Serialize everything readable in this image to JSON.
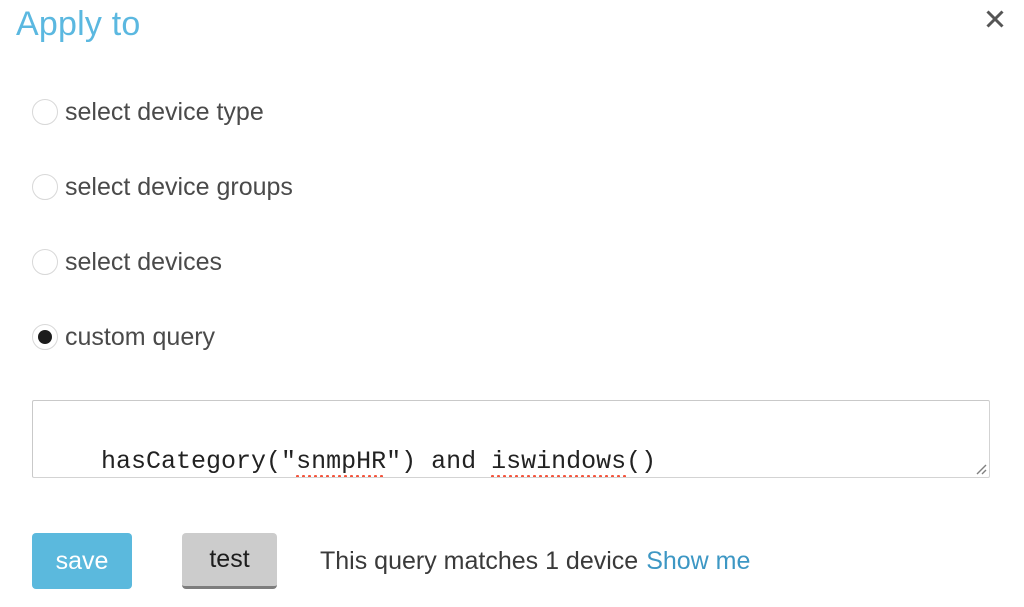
{
  "header": {
    "title": "Apply to",
    "close_icon": "close-icon",
    "title_color": "#5bb8e0",
    "close_color": "#555555"
  },
  "options": {
    "items": [
      {
        "label": "select device type",
        "selected": false
      },
      {
        "label": "select device groups",
        "selected": false
      },
      {
        "label": "select devices",
        "selected": false
      },
      {
        "label": "custom query",
        "selected": true
      }
    ]
  },
  "query": {
    "value": "hasCategory(\"snmpHR\") and iswindows()",
    "segments": [
      {
        "text": "hasCategory(\"",
        "misspelled": false
      },
      {
        "text": "snmpHR",
        "misspelled": true
      },
      {
        "text": "\") and ",
        "misspelled": false
      },
      {
        "text": "iswindows",
        "misspelled": true
      },
      {
        "text": "()",
        "misspelled": false
      }
    ],
    "spellcheck_color": "#f4553d",
    "resize_handle_icon": "resize-grip-icon"
  },
  "footer": {
    "save_label": "save",
    "test_label": "test",
    "match_text": "This query matches 1 device",
    "show_me_label": "Show me",
    "match_count": 1,
    "save_color": "#5bb9dd",
    "test_color": "#cccccc",
    "link_color": "#3d97c4"
  }
}
